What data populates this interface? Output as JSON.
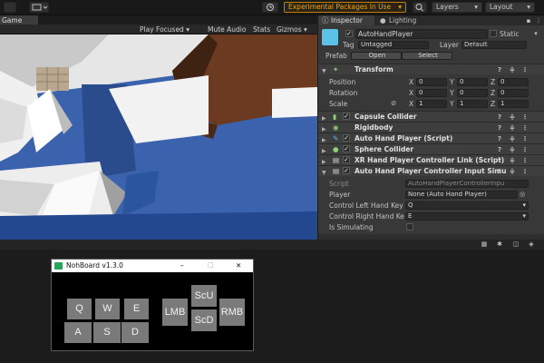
{
  "toolbar": {
    "experimental_packages": "Experimental Packages In Use",
    "layers": "Layers",
    "layout": "Layout"
  },
  "game": {
    "tab": "Game",
    "play_focused": "Play Focused",
    "mute_audio": "Mute Audio",
    "stats": "Stats",
    "gizmos": "Gizmos"
  },
  "inspector": {
    "tab_inspector": "Inspector",
    "tab_lighting": "Lighting",
    "object_name": "AutoHandPlayer",
    "static_label": "Static",
    "tag_label": "Tag",
    "tag_value": "Untagged",
    "layer_label": "Layer",
    "layer_value": "Default",
    "prefab_label": "Prefab",
    "open_btn": "Open",
    "select_btn": "Select",
    "transform": {
      "title": "Transform",
      "position": {
        "label": "Position",
        "x": "0",
        "y": "0",
        "z": "0"
      },
      "rotation": {
        "label": "Rotation",
        "x": "0",
        "y": "0",
        "z": "0"
      },
      "scale": {
        "label": "Scale",
        "x": "1",
        "y": "1",
        "z": "1"
      }
    },
    "components": [
      "Capsule Collider",
      "Rigidbody",
      "Auto Hand Player (Script)",
      "Sphere Collider",
      "XR Hand Player Controller Link (Script)",
      "Auto Hand Player Controller Input Simu"
    ],
    "fields": {
      "script_label": "Script",
      "script_value": "AutoHandPlayerControllerInpu",
      "player_label": "Player",
      "player_value": "None (Auto Hand Player)",
      "left_key_label": "Control Left Hand Key",
      "left_key_value": "Q",
      "right_key_label": "Control Right Hand Ke",
      "right_key_value": "E",
      "simulating_label": "Is Simulating"
    }
  },
  "nohboard": {
    "title": "NohBoard v1.3.0",
    "keys": {
      "q": "Q",
      "w": "W",
      "e": "E",
      "a": "A",
      "s": "S",
      "d": "D",
      "lmb": "LMB",
      "scu": "ScU",
      "scd": "ScD",
      "rmb": "RMB"
    }
  }
}
